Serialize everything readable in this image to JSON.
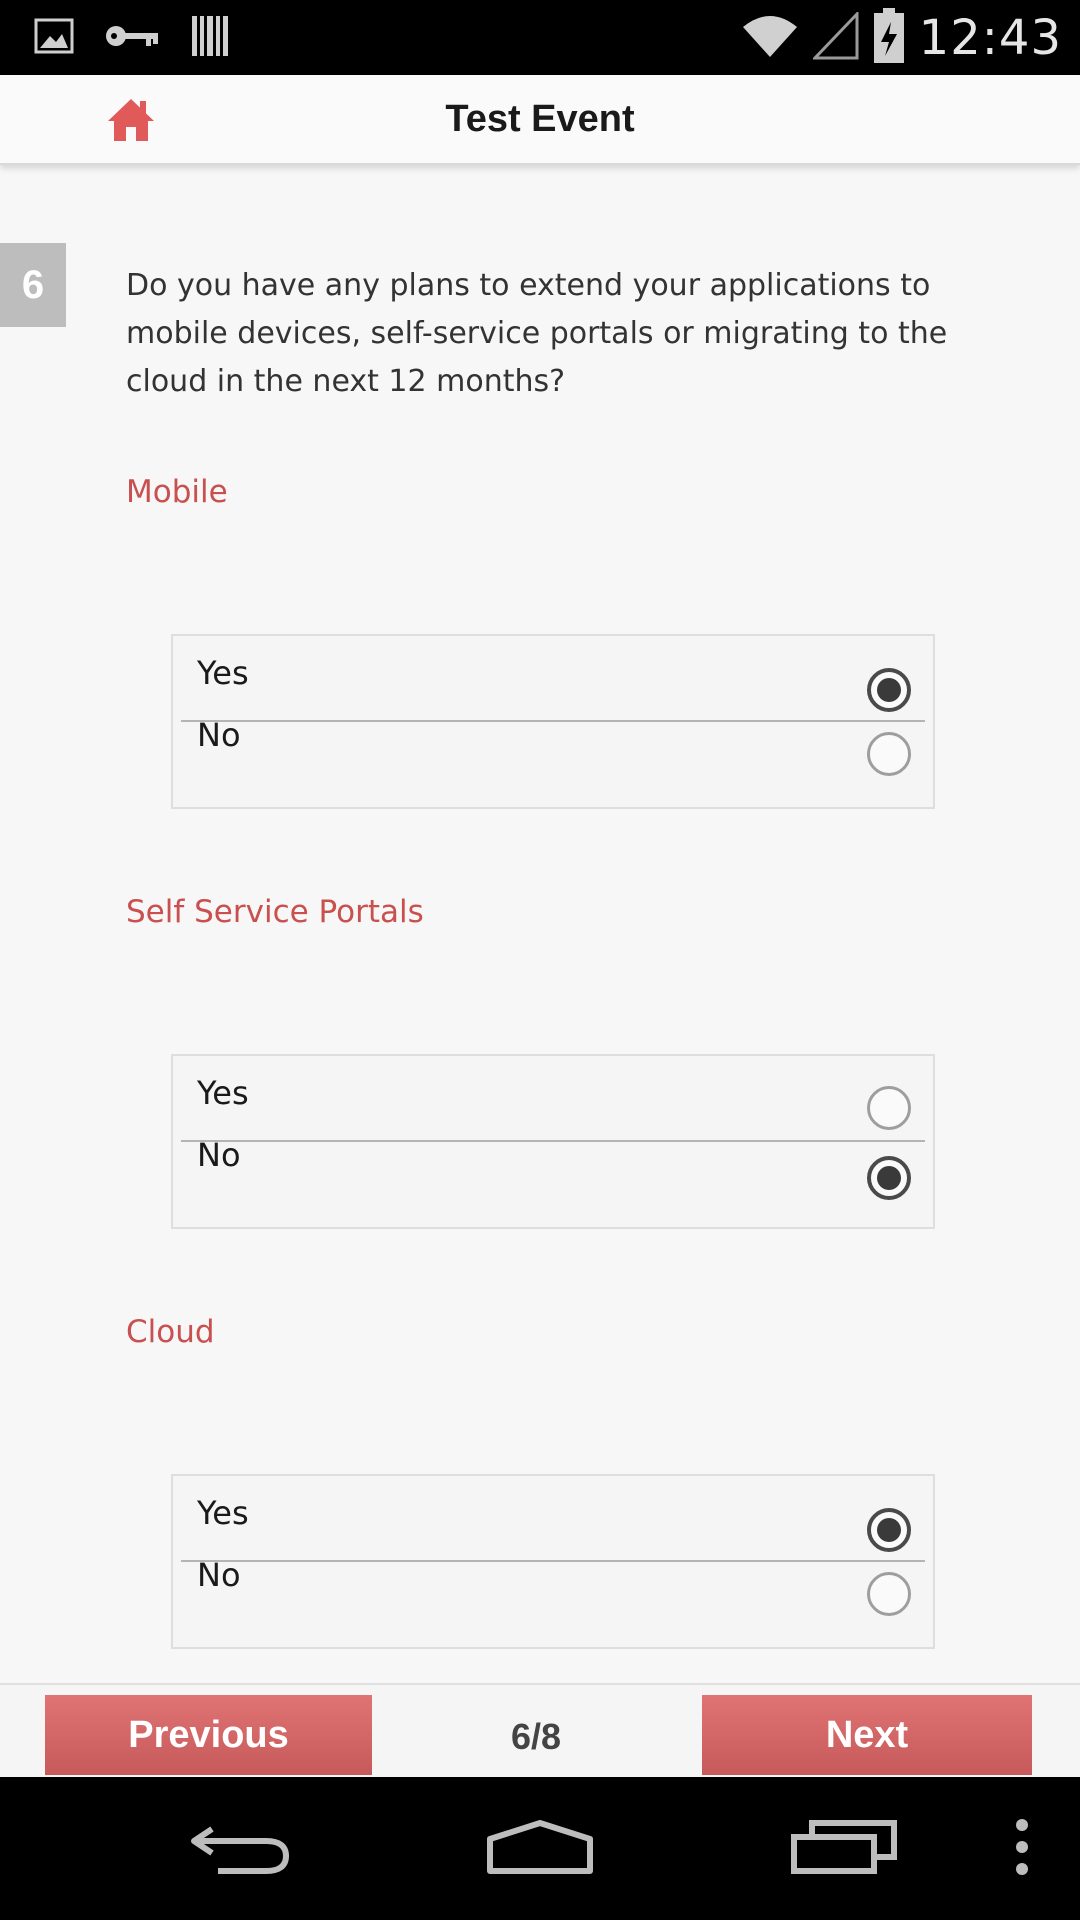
{
  "status_bar": {
    "time": "12:43",
    "icons": [
      "image-icon",
      "key-icon",
      "barcode-icon",
      "wifi-icon",
      "signal-icon",
      "battery-charging-icon"
    ]
  },
  "app_bar": {
    "title": "Test Event",
    "home_icon": "home-icon",
    "accent_color": "#e05a5a"
  },
  "question": {
    "number": "6",
    "text": "Do you have any plans to extend your applications to mobile devices, self-service portals or migrating to the cloud in the next 12 months?"
  },
  "sections": [
    {
      "label": "Mobile",
      "options": [
        {
          "label": "Yes",
          "checked": true
        },
        {
          "label": "No",
          "checked": false
        }
      ]
    },
    {
      "label": "Self Service Portals",
      "options": [
        {
          "label": "Yes",
          "checked": false
        },
        {
          "label": "No",
          "checked": true
        }
      ]
    },
    {
      "label": "Cloud",
      "options": [
        {
          "label": "Yes",
          "checked": true
        },
        {
          "label": "No",
          "checked": false
        }
      ]
    }
  ],
  "footer": {
    "previous_label": "Previous",
    "next_label": "Next",
    "page_indicator": "6/8",
    "button_color": "#d96666"
  },
  "system_nav": {
    "icons": [
      "back-icon",
      "home-nav-icon",
      "recents-icon",
      "overflow-menu-icon"
    ]
  }
}
